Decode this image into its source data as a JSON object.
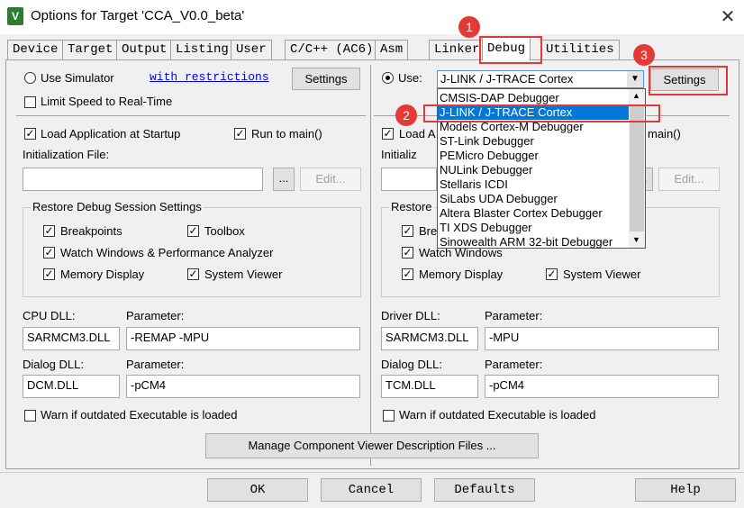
{
  "window": {
    "title": "Options for Target 'CCA_V0.0_beta'",
    "close_glyph": "✕",
    "icon_letter": "V"
  },
  "tabs": [
    "Device",
    "Target",
    "Output",
    "Listing",
    "User",
    "C/C++ (AC6)",
    "Asm",
    "Linker",
    "Debug",
    "Utilities"
  ],
  "left": {
    "use_simulator": "Use Simulator",
    "with_restrictions": "with restrictions",
    "settings": "Settings",
    "limit_speed": "Limit Speed to Real-Time",
    "load_app": "Load Application at Startup",
    "run_to_main": "Run to main()",
    "init_file_label": "Initialization File:",
    "browse": "...",
    "edit": "Edit...",
    "restore_title": "Restore Debug Session Settings",
    "breakpoints": "Breakpoints",
    "toolbox": "Toolbox",
    "watch": "Watch Windows & Performance Analyzer",
    "memory": "Memory Display",
    "system_viewer": "System Viewer",
    "cpu_dll_label": "CPU DLL:",
    "cpu_param_label": "Parameter:",
    "cpu_dll": "SARMCM3.DLL",
    "cpu_param": "-REMAP -MPU",
    "dialog_dll_label": "Dialog DLL:",
    "dialog_param_label": "Parameter:",
    "dialog_dll": "DCM.DLL",
    "dialog_param": "-pCM4",
    "warn": "Warn if outdated Executable is loaded"
  },
  "right": {
    "use": "Use:",
    "selected": "J-LINK / J-TRACE Cortex",
    "settings": "Settings",
    "load_app_partial": "Load A",
    "run_to_main_partial": "main()",
    "init_partial": "Initializ",
    "browse": "...",
    "edit": "Edit...",
    "restore_partial": "Restore",
    "breakpoints_partial": "Bre",
    "watch": "Watch Windows",
    "memory": "Memory Display",
    "system_viewer": "System Viewer",
    "driver_dll_label": "Driver DLL:",
    "driver_param_label": "Parameter:",
    "driver_dll": "SARMCM3.DLL",
    "driver_param": "-MPU",
    "dialog_dll_label": "Dialog DLL:",
    "dialog_param_label": "Parameter:",
    "dialog_dll": "TCM.DLL",
    "dialog_param": "-pCM4",
    "warn": "Warn if outdated Executable is loaded",
    "options": [
      "CMSIS-DAP Debugger",
      "J-LINK / J-TRACE Cortex",
      "Models Cortex-M Debugger",
      "ST-Link Debugger",
      "PEMicro Debugger",
      "NULink Debugger",
      "Stellaris ICDI",
      "SiLabs UDA Debugger",
      "Altera Blaster Cortex Debugger",
      "TI XDS Debugger",
      "Sinowealth ARM 32-bit Debugger"
    ]
  },
  "manage_button": "Manage Component Viewer Description Files ...",
  "buttons": {
    "ok": "OK",
    "cancel": "Cancel",
    "defaults": "Defaults",
    "help": "Help"
  },
  "annotations": [
    "1",
    "2",
    "3"
  ],
  "colors": {
    "highlight": "#0078d7",
    "annotation": "#e53935",
    "link": "#0000ee"
  }
}
